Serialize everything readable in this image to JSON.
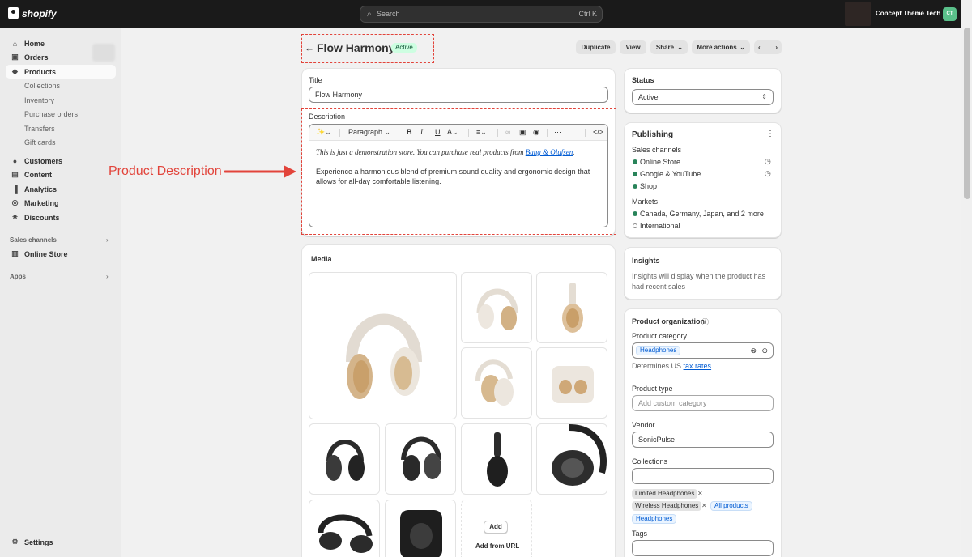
{
  "topbar": {
    "brand": "shopify",
    "search_placeholder": "Search",
    "search_shortcut": "Ctrl K",
    "store_name": "Concept Theme Tech",
    "avatar_initials": "CT"
  },
  "sidebar": {
    "items": [
      {
        "label": "Home",
        "icon": "home-icon"
      },
      {
        "label": "Orders",
        "icon": "orders-icon"
      },
      {
        "label": "Products",
        "icon": "tag-icon"
      },
      {
        "label": "Collections"
      },
      {
        "label": "Inventory"
      },
      {
        "label": "Purchase orders"
      },
      {
        "label": "Transfers"
      },
      {
        "label": "Gift cards"
      },
      {
        "label": "Customers",
        "icon": "person-icon"
      },
      {
        "label": "Content",
        "icon": "content-icon"
      },
      {
        "label": "Analytics",
        "icon": "chart-icon"
      },
      {
        "label": "Marketing",
        "icon": "target-icon"
      },
      {
        "label": "Discounts",
        "icon": "discount-icon"
      }
    ],
    "sales_channels_heading": "Sales channels",
    "online_store": "Online Store",
    "apps_heading": "Apps",
    "settings": "Settings"
  },
  "header": {
    "title": "Flow Harmony",
    "status": "Active",
    "buttons": {
      "duplicate": "Duplicate",
      "view": "View",
      "share": "Share",
      "more": "More actions"
    }
  },
  "product": {
    "title_label": "Title",
    "title_value": "Flow Harmony",
    "description_label": "Description",
    "toolbar_paragraph": "Paragraph",
    "desc_line1_prefix": "This is just a demonstration store. You can purchase real products from",
    "desc_line1_link": "Bang & Olufsen",
    "desc_line1_suffix": ".",
    "desc_line2": "Experience a harmonious blend of premium sound quality and ergonomic design that allows for all-day comfortable listening."
  },
  "annotation": {
    "text": "Product Description"
  },
  "media": {
    "heading": "Media",
    "add_label": "Add",
    "add_from_url": "Add from URL"
  },
  "status_card": {
    "heading": "Status",
    "value": "Active"
  },
  "publishing": {
    "heading": "Publishing",
    "sales_channels_label": "Sales channels",
    "channels": [
      "Online Store",
      "Google & YouTube",
      "Shop"
    ],
    "markets_label": "Markets",
    "markets": [
      "Canada, Germany, Japan, and 2 more",
      "International"
    ]
  },
  "insights": {
    "heading": "Insights",
    "text": "Insights will display when the product has had recent sales"
  },
  "organization": {
    "heading": "Product organization",
    "category_label": "Product category",
    "category_value": "Headphones",
    "tax_prefix": "Determines US",
    "tax_link": "tax rates",
    "type_label": "Product type",
    "type_placeholder": "Add custom category",
    "vendor_label": "Vendor",
    "vendor_value": "SonicPulse",
    "collections_label": "Collections",
    "collections": [
      "Limited Headphones",
      "Wireless Headphones",
      "All products",
      "Headphones"
    ],
    "tags_label": "Tags"
  },
  "colors": {
    "annotation": "#e2443b",
    "active_green": "#29845a",
    "link_blue": "#005bd3"
  }
}
